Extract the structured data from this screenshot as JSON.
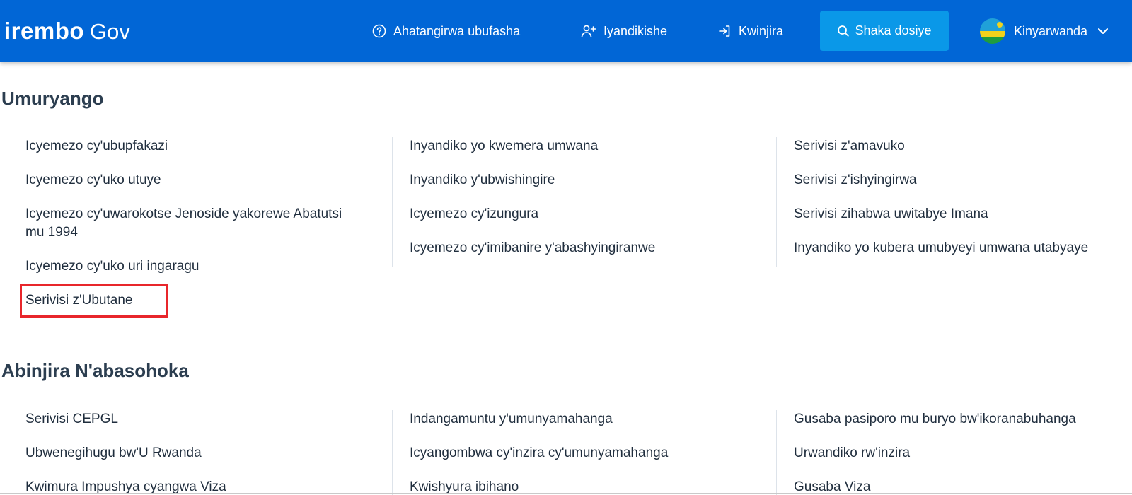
{
  "header": {
    "logo": {
      "brand": "irembo",
      "suffix": "Gov"
    },
    "nav": {
      "help": "Ahatangirwa ubufasha",
      "register": "Iyandikishe",
      "login": "Kwinjira",
      "search": "Shaka dosiye",
      "language": "Kinyarwanda"
    },
    "colors": {
      "bar": "#0166d6",
      "search_button": "#0a98e8"
    }
  },
  "sections": [
    {
      "title": "Umuryango",
      "columns": [
        [
          "Icyemezo cy'ubupfakazi",
          "Icyemezo cy'uko utuye",
          "Icyemezo cy'uwarokotse Jenoside yakorewe Abatutsi mu 1994",
          "Icyemezo cy'uko uri ingaragu",
          "Serivisi z'Ubutane"
        ],
        [
          "Inyandiko yo kwemera umwana",
          "Inyandiko y'ubwishingire",
          "Icyemezo cy'izungura",
          "Icyemezo cy'imibanire y'abashyingiranwe"
        ],
        [
          "Serivisi z'amavuko",
          "Serivisi z'ishyingirwa",
          "Serivisi zihabwa uwitabye Imana",
          "Inyandiko yo kubera umubyeyi umwana utabyaye"
        ]
      ]
    },
    {
      "title": "Abinjira N'abasohoka",
      "columns": [
        [
          "Serivisi CEPGL",
          "Ubwenegihugu bw'U Rwanda",
          "Kwimura Impushya cyangwa Viza"
        ],
        [
          "Indangamuntu y'umunyamahanga",
          "Icyangombwa cy'inzira cy'umunyamahanga",
          "Kwishyura ibihano"
        ],
        [
          "Gusaba pasiporo mu buryo bw'ikoranabuhanga",
          "Urwandiko rw'inzira",
          "Gusaba Viza"
        ]
      ]
    }
  ],
  "highlight_color": "#e8262b"
}
